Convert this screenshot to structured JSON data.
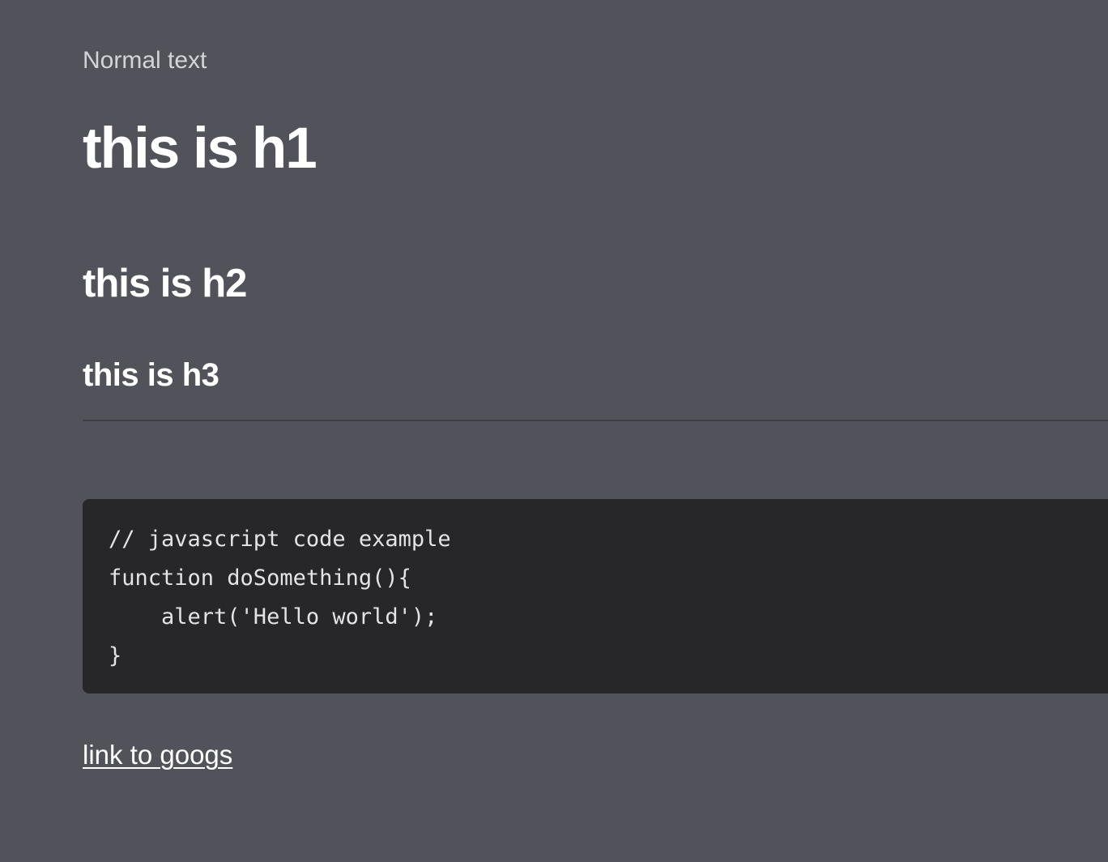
{
  "content": {
    "normal_text": "Normal text",
    "h1": "this is h1",
    "h2": "this is h2",
    "h3": "this is h3",
    "code_lines": [
      "// javascript code example",
      "function doSomething(){",
      "    alert('Hello world');",
      "}"
    ],
    "link_text": "link to googs"
  },
  "colors": {
    "background": "#52525b",
    "code_background": "#27272a",
    "divider": "#3f3f46",
    "text": "#ffffff"
  }
}
